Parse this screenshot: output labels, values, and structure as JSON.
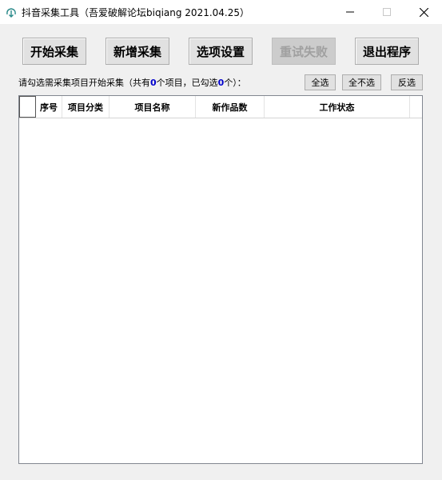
{
  "window": {
    "title": "抖音采集工具（吾爱破解论坛biqiang 2021.04.25）"
  },
  "toolbar": {
    "start_label": "开始采集",
    "add_label": "新增采集",
    "options_label": "选项设置",
    "retry_label": "重试失败",
    "exit_label": "退出程序"
  },
  "hint": {
    "prefix": "请勾选需采集项目开始采集（共有",
    "total": "0",
    "middle": "个项目，已勾选",
    "selected": "0",
    "suffix": "个）："
  },
  "selection": {
    "select_all": "全选",
    "select_none": "全不选",
    "invert": "反选"
  },
  "table": {
    "columns": [
      "序号",
      "项目分类",
      "项目名称",
      "新作品数",
      "工作状态"
    ],
    "rows": []
  },
  "colors": {
    "accent": "#0000cc",
    "button_bg": "#e1e1e1",
    "disabled_text": "#a0a0a0"
  }
}
